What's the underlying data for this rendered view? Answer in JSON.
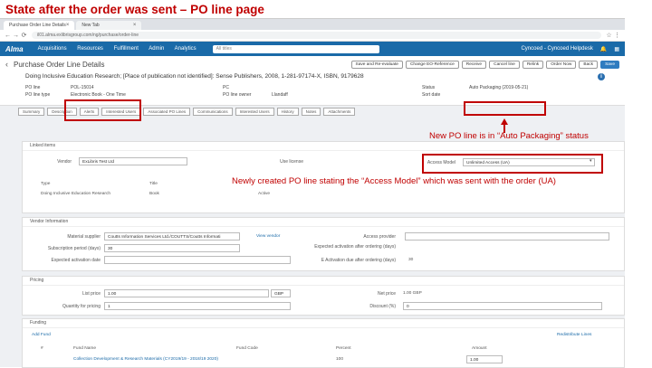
{
  "slide": {
    "title": "State after the order was sent – PO line page"
  },
  "browser": {
    "tabs": [
      {
        "label": "Purchase Order Line Details"
      },
      {
        "label": "New Tab"
      }
    ],
    "url": "il01.alma.exlibrisgroup.com/ng/purchase/order-line"
  },
  "alma": {
    "logo": "Alma",
    "nav": [
      "Acquisitions",
      "Resources",
      "Fulfillment",
      "Admin",
      "Analytics"
    ],
    "search_placeholder": "All titles",
    "user": "Cyncoed - Cyncoed Helpdesk"
  },
  "page": {
    "title": "Purchase Order Line Details",
    "buttons": [
      "Save and Re-evaluate",
      "Change EO-Reference",
      "Receive",
      "Cancel line",
      "Relink",
      "Order Now",
      "Back",
      "Save"
    ]
  },
  "summary": {
    "title_line": "Doing Inclusive Education Research; [Place of publication not identified]: Sense Publishers, 2008, 1-281-97174-X, ISBN, 9179628",
    "po_line_label": "PO line",
    "po_line_value": "POL-15014",
    "po_line_type_label": "PO line type",
    "po_line_type_value": "Electronic Book - One Time",
    "pc_label": "PC",
    "pc_value": "",
    "po_line_owner_label": "PO line owner",
    "po_line_owner_value": "Llandaff",
    "status_label": "Status",
    "status_value": "Auto Packaging (2019-05-21)",
    "sort_date_label": "Sort date",
    "sort_date_value": ""
  },
  "tabs": [
    "Summary",
    "Description",
    "Alerts",
    "Interested Users",
    "Associated PO Lines",
    "Communications",
    "Interested Users",
    "History",
    "Notes",
    "Attachments"
  ],
  "linked_items": {
    "header": "Linked items",
    "vendor_label": "Vendor",
    "vendor_value": "ExLibris Test Ltd",
    "use_license_label": "Use license",
    "access_model_label": "Access Model",
    "access_model_value": "Unlimited Access (UA)",
    "col_type": "Type",
    "col_title": "Title",
    "row_title": "Doing Inclusive Education Research",
    "row_type": "Book",
    "row_status": "Active"
  },
  "vendor_info": {
    "header": "Vendor Information",
    "material_supplier_label": "Material supplier",
    "material_supplier_value": "Coutts Information Services Ltd./COUTTS/Coutts Informati",
    "view_vendor": "View vendor",
    "access_provider_label": "Access provider",
    "subscription_period_label": "Subscription period (days)",
    "subscription_period_value": "30",
    "expected_activation_label": "Expected activation after ordering (days)",
    "activation_date_label": "Expected activation date",
    "e_activation_label": "E Activation due after ordering (days)",
    "e_activation_value": "30"
  },
  "pricing": {
    "header": "Pricing",
    "list_price_label": "List price",
    "list_price_value": "1.00",
    "currency": "GBP",
    "net_price_label": "Net price",
    "net_price_value": "1.00 GBP",
    "quantity_label": "Quantity for pricing",
    "quantity_value": "1",
    "discount_label": "Discount (%)",
    "discount_value": "0"
  },
  "funding": {
    "header": "Funding",
    "add_fund": "Add Fund",
    "redistribute": "Redistribute Lines",
    "col_hash": "#",
    "col_fund_name": "Fund Name",
    "col_fund_code": "Fund Code",
    "col_percent": "Percent",
    "col_amount": "Amount",
    "row_fund": "Collection Development & Research Materials (CY2019/19 - 2018/19 2020)",
    "row_percent": "100",
    "row_amount": "1.00"
  },
  "annotations": {
    "status_note": "New PO line is in “Auto Packaging” status",
    "access_note": "Newly created PO line stating the “Access Model” which was sent with the order (UA)"
  }
}
